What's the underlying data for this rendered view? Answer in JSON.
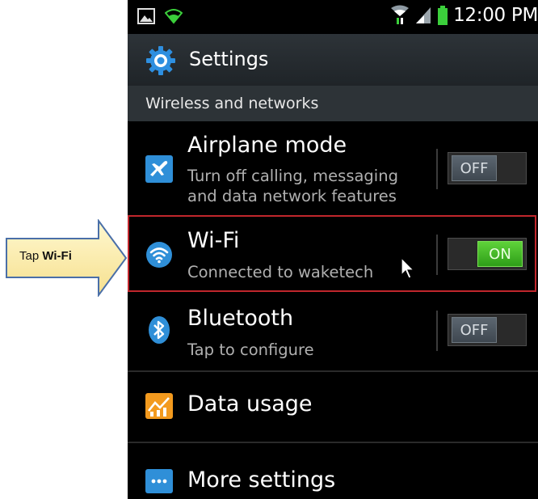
{
  "callout": {
    "prefix": "Tap ",
    "bold": "Wi-Fi"
  },
  "status_bar": {
    "time": "12:00 PM",
    "icons": [
      "image-icon",
      "wifi-signal-icon",
      "wifi-data-icon",
      "cell-signal-icon",
      "battery-icon"
    ]
  },
  "action_bar": {
    "title": "Settings",
    "icon": "gear-icon"
  },
  "section_header": "Wireless and networks",
  "items": [
    {
      "label": "Airplane mode",
      "sub1": "Turn off calling, messaging",
      "sub2": "and data network features",
      "icon": "airplane-icon",
      "toggle": "OFF"
    },
    {
      "label": "Wi-Fi",
      "sub1": "Connected to waketech",
      "icon": "wifi-icon",
      "toggle": "ON"
    },
    {
      "label": "Bluetooth",
      "sub1": "Tap to configure",
      "icon": "bluetooth-icon",
      "toggle": "OFF"
    },
    {
      "label": "Data usage",
      "icon": "chart-icon"
    },
    {
      "label": "More settings",
      "icon": "more-icon"
    }
  ],
  "colors": {
    "highlight_border": "#c0262c",
    "toggle_on": "#3fb51f",
    "toggle_off": "#4f5a63",
    "action_bar": "#252b2f"
  }
}
